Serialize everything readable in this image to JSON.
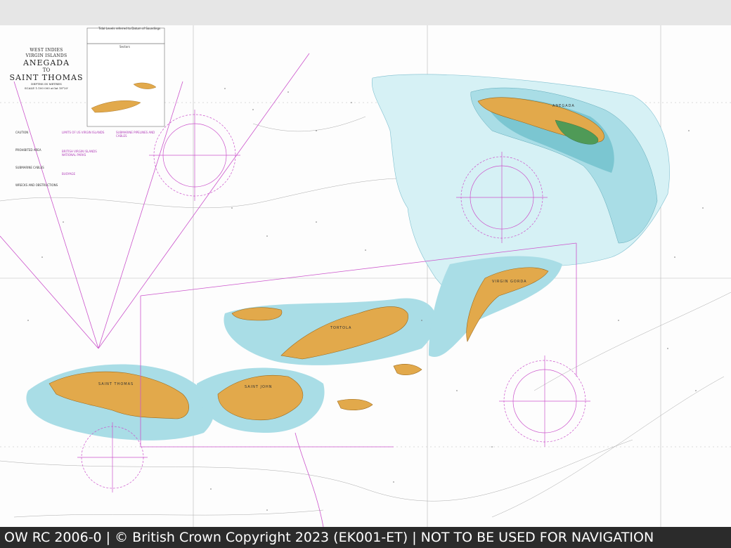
{
  "chart_title": {
    "region": "WEST INDIES",
    "subregion": "VIRGIN ISLANDS",
    "line1": "ANEGADA",
    "line2": "TO",
    "line3": "SAINT THOMAS",
    "depths": "DEPTHS IN METRES",
    "scale": "SCALE 1:100 000 at lat 18°20'"
  },
  "table_title": "Tidal Levels referred to Datum of Soundings",
  "inset_title": "Sectors",
  "place_names": {
    "anegada": "ANEGADA",
    "st_thomas": "SAINT THOMAS",
    "st_john": "SAINT JOHN",
    "tortola": "TORTOLA",
    "virgin_gorda": "VIRGIN GORDA"
  },
  "notes": {
    "left_headings": [
      "CAUTION",
      "PROHIBITED AREA",
      "SUBMARINE CABLES",
      "WRECKS AND OBSTRUCTIONS"
    ],
    "center_headings": [
      "LIMITS OF US VIRGIN ISLANDS",
      "BRITISH VIRGIN ISLANDS NATIONAL PARKS",
      "BUOYAGE",
      "SUBMARINE PIPELINES AND CABLES"
    ]
  },
  "footer": {
    "text": "OW RC 2006-0 | © British Crown Copyright 2023 (EK001-ET) | NOT TO BE USED FOR NAVIGATION"
  },
  "colors": {
    "land": "#e2a94b",
    "land_stroke": "#9c6a1c",
    "shallow": "#a9dde6",
    "medium": "#d6f1f5",
    "deep_band": "#6fc1cc",
    "mangrove": "#4f9a57",
    "magenta": "#cc55cc",
    "footer_bg": "#2b2b2b",
    "background": "#e6e6e6"
  }
}
